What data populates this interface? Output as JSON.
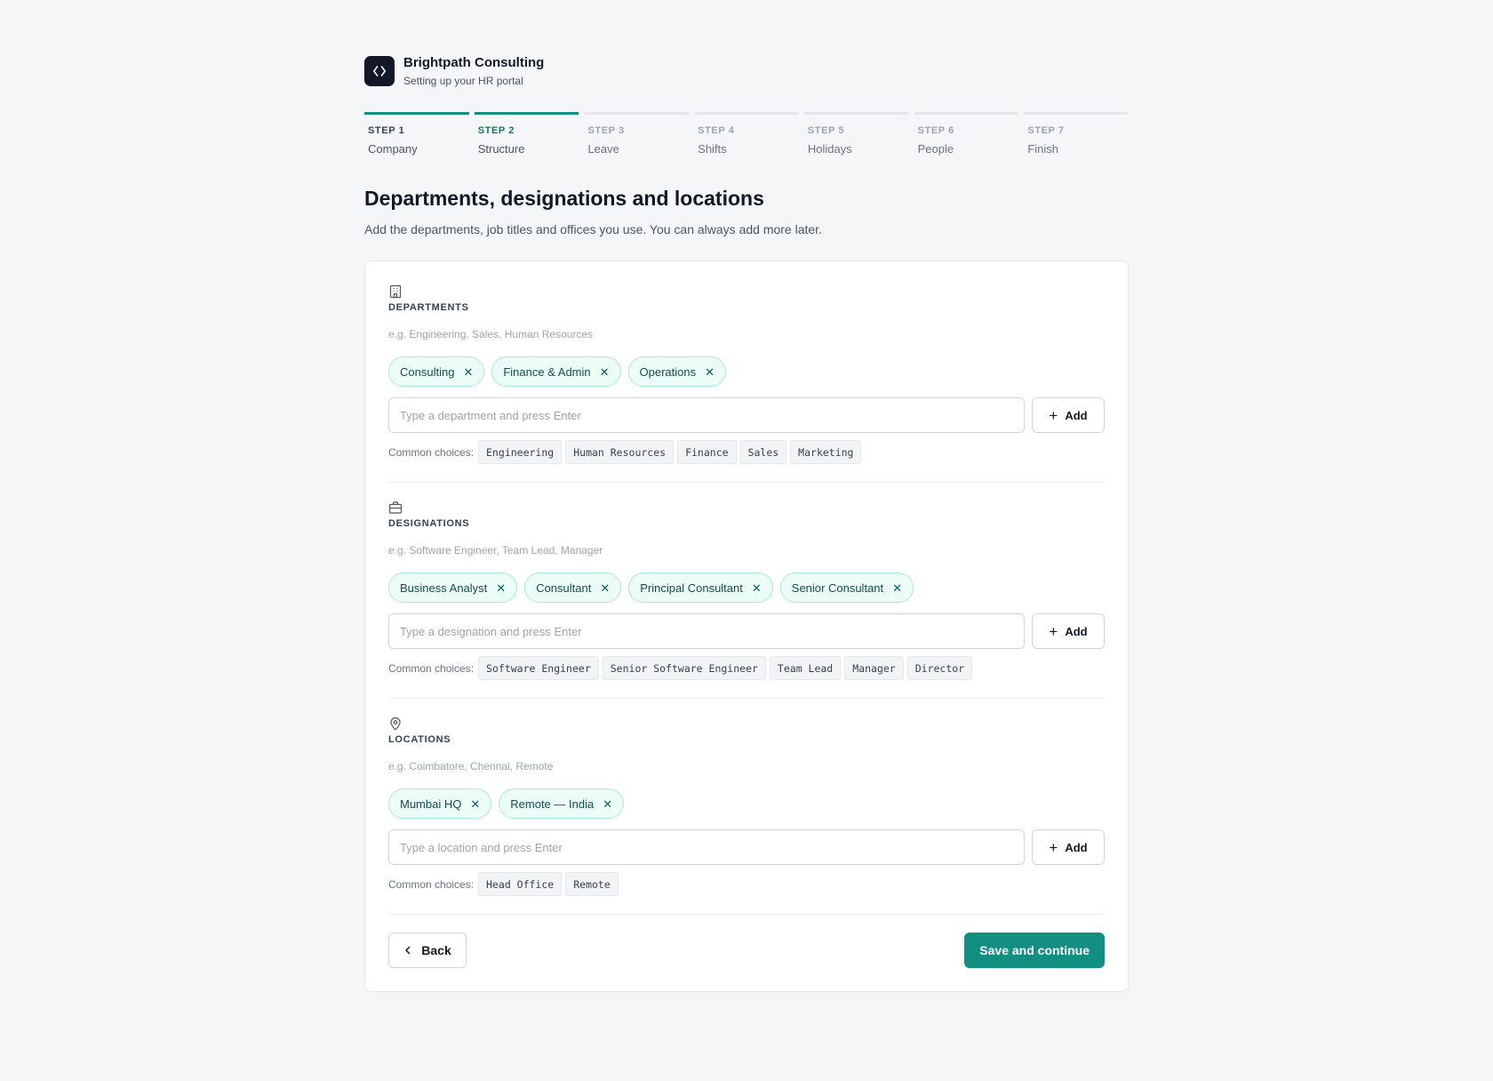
{
  "brand": {
    "name": "Brightpath Consulting",
    "subtitle": "Setting up your HR portal",
    "logo_icon": "code-brackets-icon"
  },
  "steps": [
    {
      "number": "STEP 1",
      "label": "Company",
      "state": "done"
    },
    {
      "number": "STEP 2",
      "label": "Structure",
      "state": "current"
    },
    {
      "number": "STEP 3",
      "label": "Leave",
      "state": "upcoming"
    },
    {
      "number": "STEP 4",
      "label": "Shifts",
      "state": "upcoming"
    },
    {
      "number": "STEP 5",
      "label": "Holidays",
      "state": "upcoming"
    },
    {
      "number": "STEP 6",
      "label": "People",
      "state": "upcoming"
    },
    {
      "number": "STEP 7",
      "label": "Finish",
      "state": "upcoming"
    }
  ],
  "page": {
    "title": "Departments, designations and locations",
    "subtitle": "Add the departments, job titles and offices you use. You can always add more later."
  },
  "sections": {
    "departments": {
      "icon": "building-icon",
      "title": "DEPARTMENTS",
      "hint": "e.g. Engineering, Sales, Human Resources",
      "chips": [
        "Consulting",
        "Finance & Admin",
        "Operations"
      ],
      "input_placeholder": "Type a department and press Enter",
      "input_value": "",
      "add_label": "Add",
      "common_label": "Common choices:",
      "common": [
        "Engineering",
        "Human Resources",
        "Finance",
        "Sales",
        "Marketing"
      ]
    },
    "designations": {
      "icon": "briefcase-icon",
      "title": "DESIGNATIONS",
      "hint": "e.g. Software Engineer, Team Lead, Manager",
      "chips": [
        "Business Analyst",
        "Consultant",
        "Principal Consultant",
        "Senior Consultant"
      ],
      "input_placeholder": "Type a designation and press Enter",
      "input_value": "",
      "add_label": "Add",
      "common_label": "Common choices:",
      "common": [
        "Software Engineer",
        "Senior Software Engineer",
        "Team Lead",
        "Manager",
        "Director"
      ]
    },
    "locations": {
      "icon": "map-pin-icon",
      "title": "LOCATIONS",
      "hint": "e.g. Coimbatore, Chennai, Remote",
      "chips": [
        "Mumbai HQ",
        "Remote — India"
      ],
      "input_placeholder": "Type a location and press Enter",
      "input_value": "",
      "add_label": "Add",
      "common_label": "Common choices:",
      "common": [
        "Head Office",
        "Remote"
      ]
    }
  },
  "footer": {
    "back_label": "Back",
    "continue_label": "Save and continue"
  },
  "colors": {
    "accent": "#138f82",
    "chip_bg": "#ecfdf8",
    "chip_border": "#a7e9d8",
    "page_bg": "#f5f6f8"
  }
}
